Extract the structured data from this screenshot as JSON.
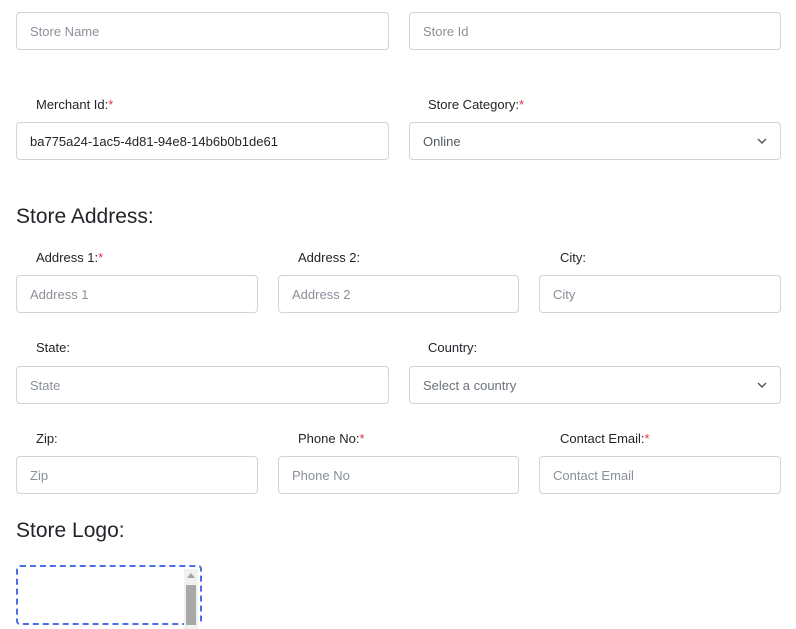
{
  "store": {
    "name_placeholder": "Store Name",
    "id_placeholder": "Store Id",
    "merchant_label": "Merchant Id:",
    "merchant_value": "ba775a24-1ac5-4d81-94e8-14b6b0b1de61",
    "category_label": "Store Category:",
    "category_value": "Online"
  },
  "address": {
    "title": "Store Address:",
    "address1_label": "Address 1:",
    "address1_placeholder": "Address 1",
    "address2_label": "Address 2:",
    "address2_placeholder": "Address 2",
    "city_label": "City:",
    "city_placeholder": "City",
    "state_label": "State:",
    "state_placeholder": "State",
    "country_label": "Country:",
    "country_placeholder": "Select a country",
    "zip_label": "Zip:",
    "zip_placeholder": "Zip",
    "phone_label": "Phone No:",
    "phone_placeholder": "Phone No",
    "email_label": "Contact Email:",
    "email_placeholder": "Contact Email"
  },
  "logo": {
    "title": "Store Logo:"
  },
  "required_mark": "*",
  "colors": {
    "required": "#dc3545",
    "dropzone_border": "#4b6ee8",
    "input_border": "#ced4da"
  }
}
